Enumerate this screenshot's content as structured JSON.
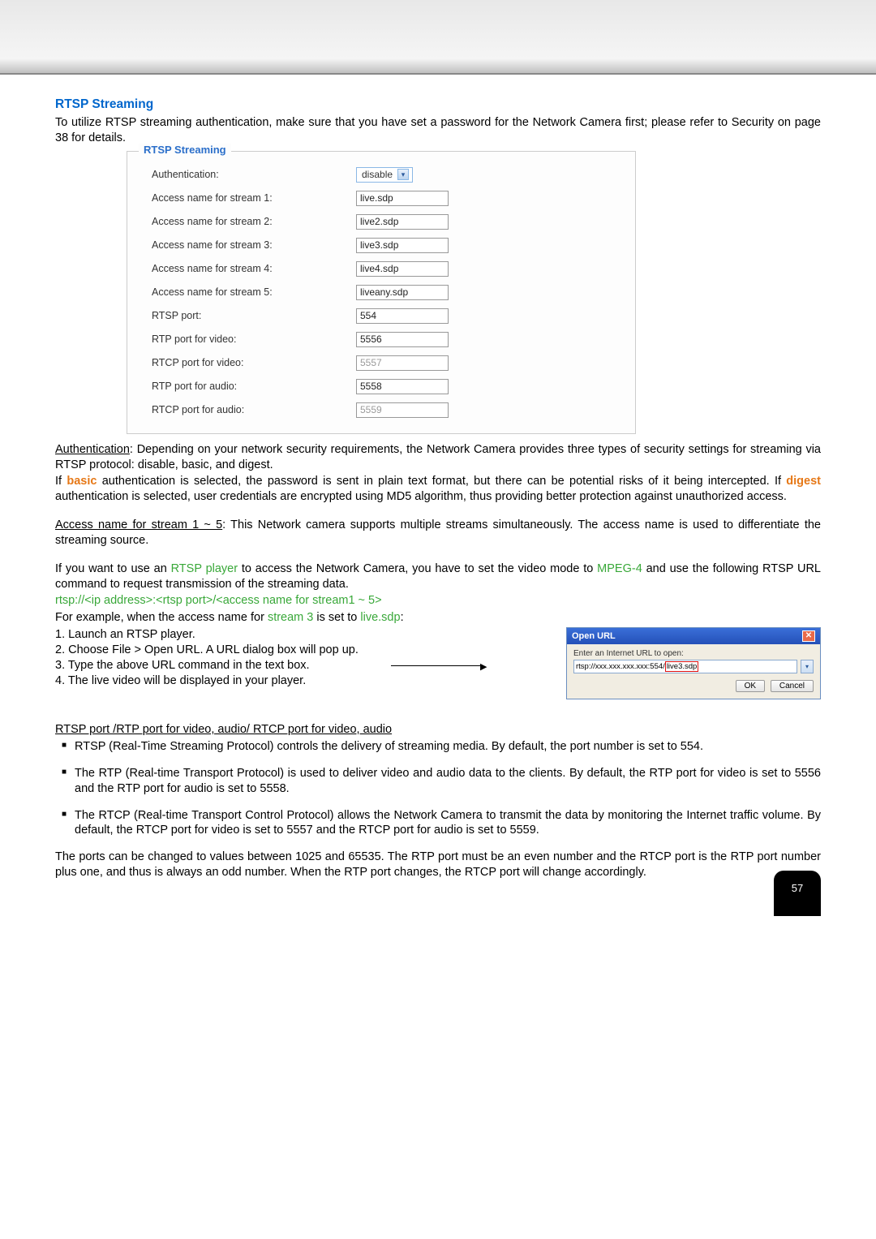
{
  "section_title": "RTSP Streaming",
  "intro": "To utilize RTSP streaming authentication, make sure that you have set a password for the Network Camera first; please refer to Security on page 38 for details.",
  "fieldset": {
    "legend": "RTSP Streaming",
    "rows": [
      {
        "label": "Authentication:",
        "type": "select",
        "value": "disable"
      },
      {
        "label": "Access name for stream 1:",
        "type": "text",
        "value": "live.sdp"
      },
      {
        "label": "Access name for stream 2:",
        "type": "text",
        "value": "live2.sdp"
      },
      {
        "label": "Access name for stream 3:",
        "type": "text",
        "value": "live3.sdp"
      },
      {
        "label": "Access name for stream 4:",
        "type": "text",
        "value": "live4.sdp"
      },
      {
        "label": "Access name for stream 5:",
        "type": "text",
        "value": "liveany.sdp"
      },
      {
        "label": "RTSP port:",
        "type": "text",
        "value": "554"
      },
      {
        "label": "RTP port for video:",
        "type": "text",
        "value": "5556"
      },
      {
        "label": "RTCP port for video:",
        "type": "text",
        "value": "5557",
        "disabled": true
      },
      {
        "label": "RTP port for audio:",
        "type": "text",
        "value": "5558"
      },
      {
        "label": "RTCP port for audio:",
        "type": "text",
        "value": "5559",
        "disabled": true
      }
    ]
  },
  "auth_para": {
    "lead_underline": "Authentication",
    "text": ": Depending on your network security requirements, the Network Camera provides three types of security settings for streaming via RTSP protocol: disable, basic, and digest."
  },
  "auth_para2_prefix": "If ",
  "auth_basic": "basic",
  "auth_para2_mid": " authentication is selected, the password is sent in plain text format, but there can be potential risks of it being intercepted. If ",
  "auth_digest": "digest",
  "auth_para2_suffix": " authentication is selected, user credentials are encrypted using MD5 algorithm, thus providing better protection against unauthorized access.",
  "access_para": {
    "lead_underline": "Access name for stream 1 ~ 5",
    "text": ": This Network camera supports multiple streams simultaneously. The access name is used to differentiate the streaming source."
  },
  "rtsp_player_para_prefix": "If you want to use an ",
  "rtsp_player_label": "RTSP player",
  "rtsp_player_para_mid": " to access the Network Camera, you have to set the video mode to ",
  "mpeg4_label": "MPEG-4",
  "rtsp_player_para_suffix": " and use the following RTSP URL command to request transmission of the streaming data.",
  "rtsp_url_template": "rtsp://<ip address>:<rtsp port>/<access name for stream1 ~ 5>",
  "example_prefix": "For example, when the access name for ",
  "example_stream": "stream 3",
  "example_mid": " is set to ",
  "example_sdp": "live.sdp",
  "example_suffix": ":",
  "steps": [
    "1. Launch an RTSP player.",
    "2. Choose File > Open URL. A URL dialog box will pop up.",
    "3. Type the above URL command in the text box.",
    "4. The live video will be displayed in your player."
  ],
  "dialog": {
    "title": "Open URL",
    "label": "Enter an Internet URL to open:",
    "url_part1": "rtsp://xxx.xxx.xxx.xxx:554/",
    "url_part2": "live3.sdp",
    "ok": "OK",
    "cancel": "Cancel"
  },
  "ports_heading": "RTSP port /RTP port for video, audio/ RTCP port for video, audio",
  "ports_bullets": [
    "RTSP (Real-Time Streaming Protocol) controls the delivery of streaming media. By default, the port number is set to 554.",
    "The RTP (Real-time Transport Protocol) is used to deliver video and audio data to the clients. By default, the RTP port for video is set to 5556 and the RTP port for audio is set to 5558.",
    "The RTCP (Real-time Transport Control Protocol) allows the Network Camera to transmit the data by monitoring the Internet traffic volume. By default, the RTCP port for video is set to 5557 and the RTCP port for audio is set to 5559."
  ],
  "ports_footer": "The ports can be changed to values between 1025 and 65535. The RTP port must be an even number and the RTCP port is the RTP port number plus one, and thus is always an odd number. When the RTP port changes, the RTCP port will change accordingly.",
  "page_number": "57"
}
